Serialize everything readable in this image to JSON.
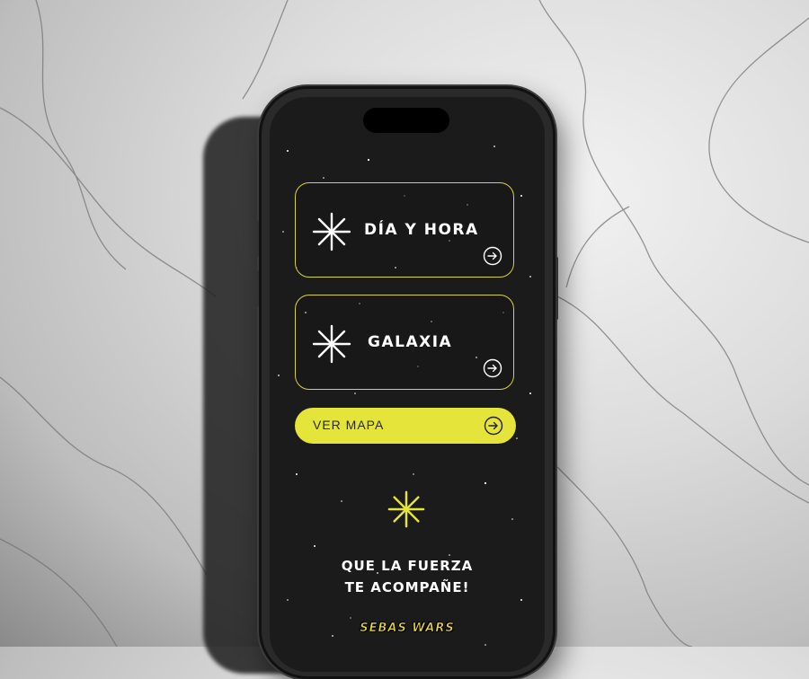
{
  "menu": {
    "items": [
      {
        "label": "DÍA Y HORA",
        "icon": "sparkle-icon",
        "action_icon": "arrow-right-circle-icon"
      },
      {
        "label": "GALAXIA",
        "icon": "sparkle-icon",
        "action_icon": "arrow-right-circle-icon"
      }
    ]
  },
  "map_button": {
    "label": "VER MAPA",
    "icon": "arrow-right-circle-icon"
  },
  "quote": {
    "line1": "QUE LA FUERZA",
    "line2": "TE ACOMPAÑE!"
  },
  "brand": {
    "logo_text": "SEBAS WARS"
  },
  "colors": {
    "accent": "#e5e43a",
    "screen_bg": "#1b1b1b",
    "text": "#ffffff"
  }
}
